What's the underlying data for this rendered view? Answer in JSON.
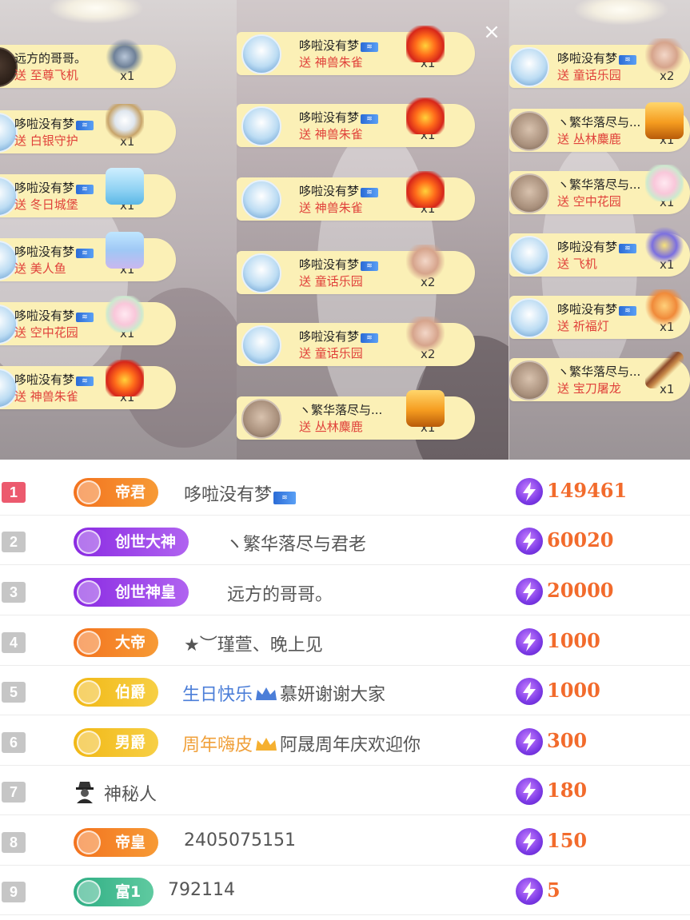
{
  "feeds": {
    "col1": [
      {
        "name": "远方的哥哥。",
        "badge": false,
        "send": "送 至尊飞机",
        "count": "x1",
        "avatar": "dark",
        "icon": "jet"
      },
      {
        "name": "哆啦没有梦",
        "badge": true,
        "send": "送 白银守护",
        "count": "x1",
        "avatar": "doraemon",
        "icon": "shield"
      },
      {
        "name": "哆啦没有梦",
        "badge": true,
        "send": "送 冬日城堡",
        "count": "x1",
        "avatar": "doraemon",
        "icon": "castle"
      },
      {
        "name": "哆啦没有梦",
        "badge": true,
        "send": "送 美人鱼",
        "count": "x1",
        "avatar": "doraemon",
        "icon": "mermaid"
      },
      {
        "name": "哆啦没有梦",
        "badge": true,
        "send": "送 空中花园",
        "count": "x1",
        "avatar": "doraemon",
        "icon": "garden"
      },
      {
        "name": "哆啦没有梦",
        "badge": true,
        "send": "送 神兽朱雀",
        "count": "x1",
        "avatar": "doraemon",
        "icon": "phoenix"
      }
    ],
    "col2": [
      {
        "name": "哆啦没有梦",
        "badge": true,
        "send": "送 神兽朱雀",
        "count": "x1",
        "avatar": "doraemon",
        "icon": "phoenix"
      },
      {
        "name": "哆啦没有梦",
        "badge": true,
        "send": "送 神兽朱雀",
        "count": "x1",
        "avatar": "doraemon",
        "icon": "phoenix"
      },
      {
        "name": "哆啦没有梦",
        "badge": true,
        "send": "送 神兽朱雀",
        "count": "x1",
        "avatar": "doraemon",
        "icon": "phoenix"
      },
      {
        "name": "哆啦没有梦",
        "badge": true,
        "send": "送 童话乐园",
        "count": "x2",
        "avatar": "doraemon",
        "icon": "carousel"
      },
      {
        "name": "哆啦没有梦",
        "badge": true,
        "send": "送 童话乐园",
        "count": "x2",
        "avatar": "doraemon",
        "icon": "carousel"
      },
      {
        "name": "ヽ繁华落尽与...",
        "badge": false,
        "send": "送 丛林麋鹿",
        "count": "x1",
        "avatar": "face",
        "icon": "deer"
      }
    ],
    "col3": [
      {
        "name": "哆啦没有梦",
        "badge": true,
        "send": "送 童话乐园",
        "count": "x2",
        "avatar": "doraemon",
        "icon": "carousel"
      },
      {
        "name": "ヽ繁华落尽与...",
        "badge": false,
        "send": "送 丛林麋鹿",
        "count": "x1",
        "avatar": "face",
        "icon": "deer"
      },
      {
        "name": "ヽ繁华落尽与...",
        "badge": false,
        "send": "送 空中花园",
        "count": "x1",
        "avatar": "face",
        "icon": "garden"
      },
      {
        "name": "哆啦没有梦",
        "badge": true,
        "send": "送 飞机",
        "count": "x1",
        "avatar": "doraemon",
        "icon": "plane"
      },
      {
        "name": "哆啦没有梦",
        "badge": true,
        "send": "送 祈福灯",
        "count": "x1",
        "avatar": "doraemon",
        "icon": "lamp"
      },
      {
        "name": "ヽ繁华落尽与...",
        "badge": false,
        "send": "送 宝刀屠龙",
        "count": "x1",
        "avatar": "face",
        "icon": "sword"
      }
    ],
    "close_label": "×"
  },
  "ranking": [
    {
      "rank": "1",
      "level": "帝君",
      "level_color": "orange",
      "name": "哆啦没有梦",
      "badge": true,
      "score": "149461"
    },
    {
      "rank": "2",
      "level": "创世大神",
      "level_color": "purple",
      "name": "ヽ繁华落尽与君老",
      "score": "60020"
    },
    {
      "rank": "3",
      "level": "创世神皇",
      "level_color": "purple",
      "name": "远方的哥哥。",
      "score": "20000"
    },
    {
      "rank": "4",
      "level": "大帝",
      "level_color": "orange",
      "name": "★︶瑾萱、晚上见",
      "score": "1000"
    },
    {
      "rank": "5",
      "level": "伯爵",
      "level_color": "gold",
      "name_prefix": "生日快乐",
      "prefix_color": "blue",
      "name": "慕妍谢谢大家",
      "score": "1000"
    },
    {
      "rank": "6",
      "level": "男爵",
      "level_color": "gold",
      "name_prefix": "周年嗨皮",
      "prefix_color": "orange",
      "name": "阿晟周年庆欢迎你",
      "score": "300"
    },
    {
      "rank": "7",
      "level": "",
      "name": "神秘人",
      "mystery": true,
      "score": "180"
    },
    {
      "rank": "8",
      "level": "帝皇",
      "level_color": "orange",
      "name": "2405075151",
      "score": "150"
    },
    {
      "rank": "9",
      "level": "富1",
      "level_color": "teal",
      "name": "792114",
      "score": "5"
    }
  ],
  "colors": {
    "accent_red": "#e0413a",
    "score_orange": "#f26b2c",
    "gift_bar": "#fbf0b6",
    "rank_first": "#ec5a6e"
  }
}
